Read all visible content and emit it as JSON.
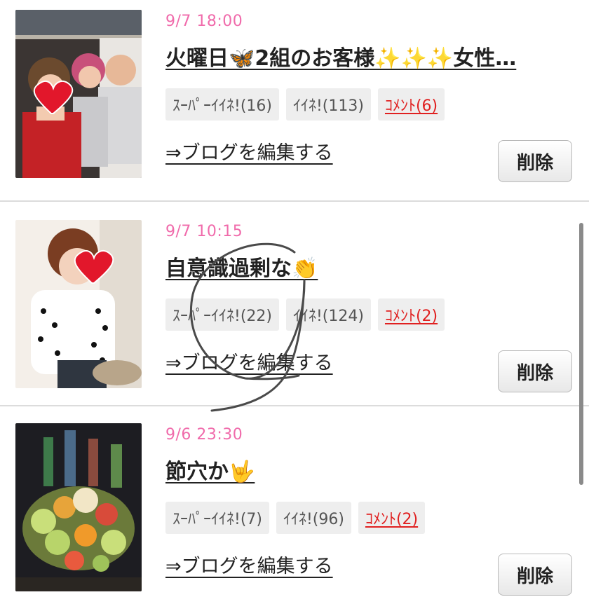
{
  "entries": [
    {
      "date": "9/7 18:00",
      "title": "火曜日🦋2組のお客様✨✨✨女性…",
      "tags": {
        "super_like": "ｽｰﾊﾟｰｲｲﾈ!(16)",
        "like": "ｲｲﾈ!(113)",
        "comment": "ｺﾒﾝﾄ(6)"
      },
      "edit_link": "⇒ブログを編集する",
      "delete_label": "削除",
      "thumb_icon": "heart-emoji"
    },
    {
      "date": "9/7 10:15",
      "title": "自意識過剰な👏",
      "tags": {
        "super_like": "ｽｰﾊﾟｰｲｲﾈ!(22)",
        "like": "ｲｲﾈ!(124)",
        "comment": "ｺﾒﾝﾄ(2)"
      },
      "edit_link": "⇒ブログを編集する",
      "delete_label": "削除",
      "thumb_icon": "heart-emoji"
    },
    {
      "date": "9/6 23:30",
      "title": "節穴か🤟",
      "tags": {
        "super_like": "ｽｰﾊﾟｰｲｲﾈ!(7)",
        "like": "ｲｲﾈ!(96)",
        "comment": "ｺﾒﾝﾄ(2)"
      },
      "edit_link": "⇒ブログを編集する",
      "delete_label": "削除",
      "thumb_icon": "fruit-platter"
    }
  ],
  "colors": {
    "date": "#f06bab",
    "comment": "#e02020",
    "tag_bg": "#eeeeee"
  }
}
